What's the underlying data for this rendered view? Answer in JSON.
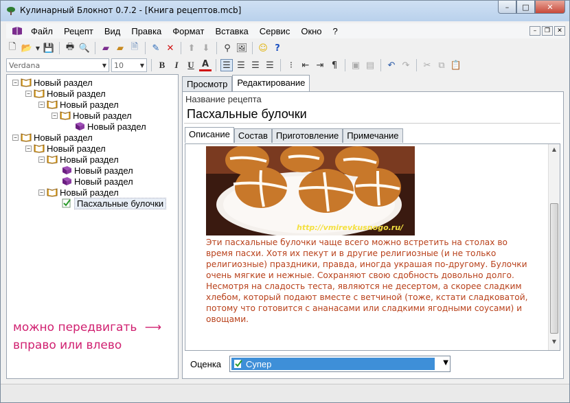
{
  "window": {
    "title": "Кулинарный Блокнот 0.7.2 - [Книга рецептов.mcb]",
    "controls": [
      "–",
      "□",
      "✕"
    ]
  },
  "menu": [
    "Файл",
    "Рецепт",
    "Вид",
    "Правка",
    "Формат",
    "Вставка",
    "Сервис",
    "Окно",
    "?"
  ],
  "format_toolbar": {
    "font": "Verdana",
    "size": "10"
  },
  "tree": [
    {
      "label": "Новый раздел",
      "level": 0
    },
    {
      "label": "Новый раздел",
      "level": 1
    },
    {
      "label": "Новый раздел",
      "level": 2
    },
    {
      "label": "Новый раздел",
      "level": 3
    },
    {
      "label": "Новый раздел",
      "level": 4
    },
    {
      "label": "Новый раздел",
      "level": 0
    },
    {
      "label": "Новый раздел",
      "level": 1
    },
    {
      "label": "Новый раздел",
      "level": 2
    },
    {
      "label": "Новый раздел",
      "level": 3
    },
    {
      "label": "Новый раздел",
      "level": 3
    },
    {
      "label": "Новый раздел",
      "level": 2
    },
    {
      "label": "Пасхальные булочки",
      "level": 3
    }
  ],
  "annotation": {
    "line1": "можно передвигать",
    "line2": "вправо или влево",
    "arrow1": "⟶",
    "arrow2": "⟵"
  },
  "main_tabs": [
    "Просмотр",
    "Редактирование"
  ],
  "recipe": {
    "name_label": "Название рецепта",
    "name": "Пасхальные булочки",
    "subtabs": [
      "Описание",
      "Состав",
      "Приготовление",
      "Примечание"
    ],
    "photo_caption": "http://vmirevkusnogo.ru/",
    "description": "Эти пасхальные булочки чаще всего можно встретить на столах во время пасхи. Хотя их пекут и в другие религиозные (и не только религиозные) праздники, правда, иногда украшая по-другому. Булочки очень мягкие и нежные. Сохраняют свою сдобность довольно долго. Несмотря на сладость теста, являются не десертом, а скорее сладким хлебом, который подают вместе с ветчиной (тоже, кстати сладковатой, потому что готовится с ананасами или сладкими ягодными соусами) и овощами.",
    "rating_label": "Оценка",
    "rating_value": "Супер"
  }
}
